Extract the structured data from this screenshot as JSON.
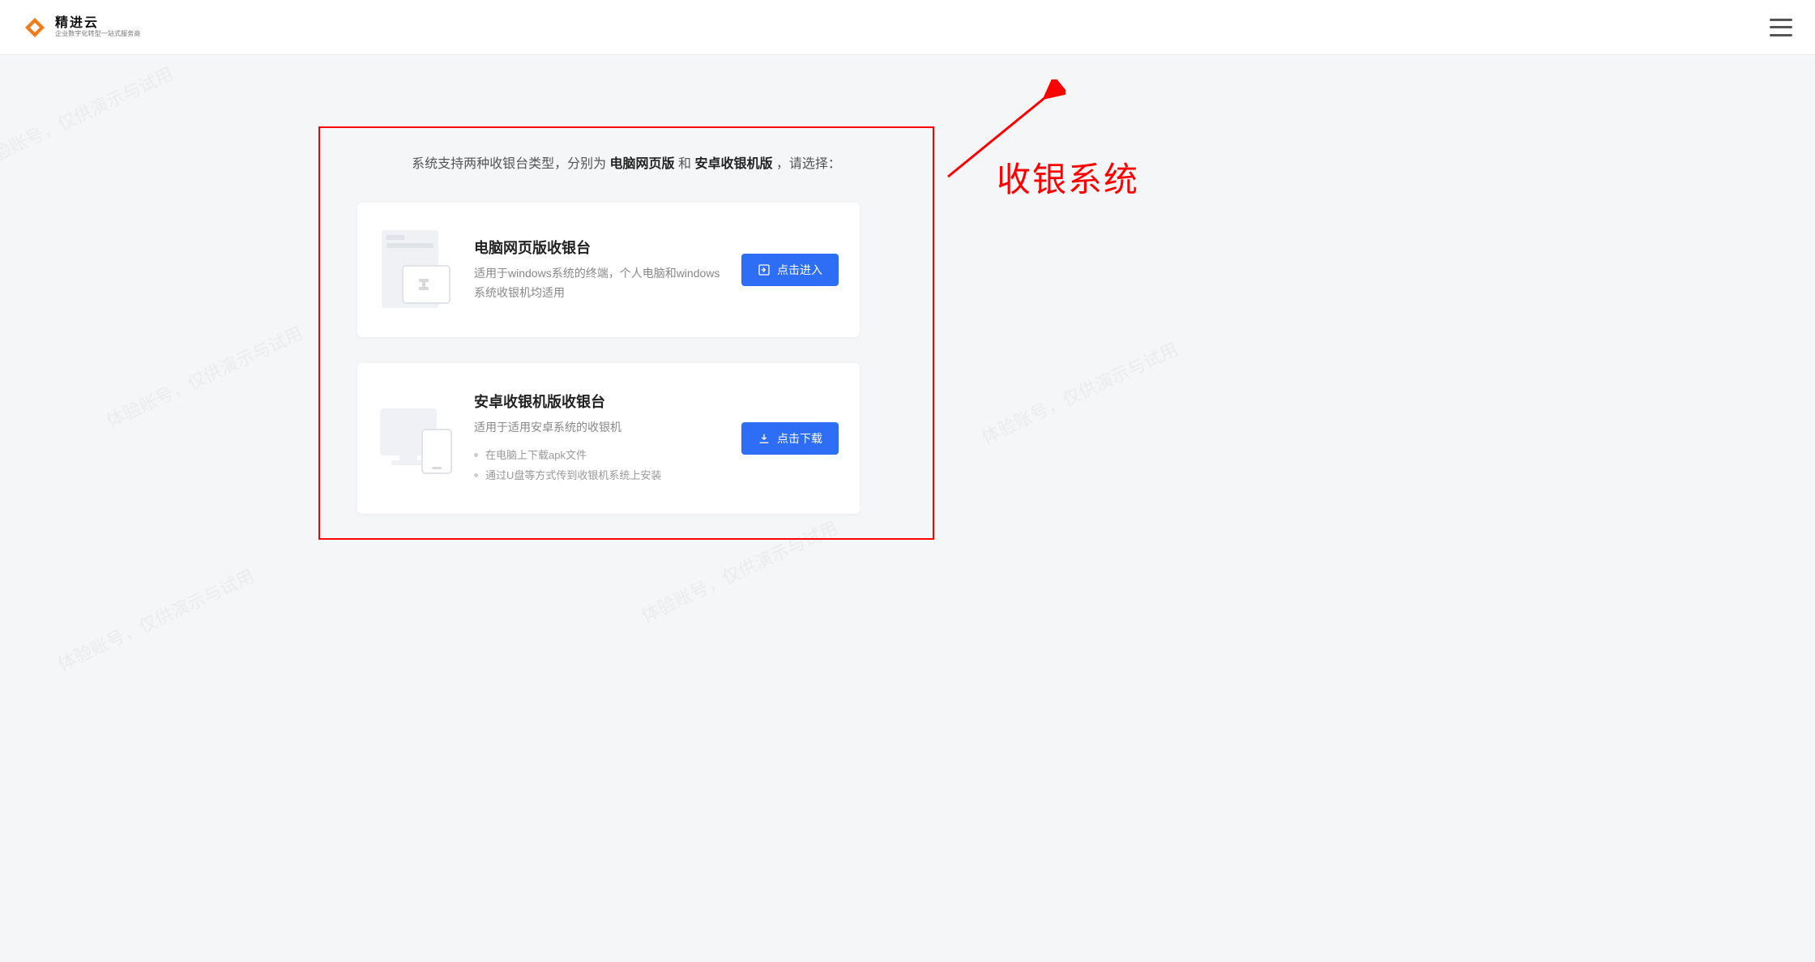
{
  "header": {
    "brand_name": "精进云",
    "brand_sub": "企业数字化转型一站式服务商"
  },
  "watermark_text": "体验账号，仅供演示与试用",
  "intro": {
    "prefix": "系统支持两种收银台类型，分别为 ",
    "bold1": "电脑网页版",
    "mid": " 和 ",
    "bold2": "安卓收银机版",
    "suffix": " ，请选择："
  },
  "cards": {
    "web": {
      "title": "电脑网页版收银台",
      "desc": "适用于windows系统的终端，个人电脑和windows系统收银机均适用",
      "button": "点击进入"
    },
    "android": {
      "title": "安卓收银机版收银台",
      "desc": "适用于适用安卓系统的收银机",
      "steps": [
        "在电脑上下载apk文件",
        "通过U盘等方式传到收银机系统上安装"
      ],
      "button": "点击下载"
    }
  },
  "annotation": "收银系统"
}
